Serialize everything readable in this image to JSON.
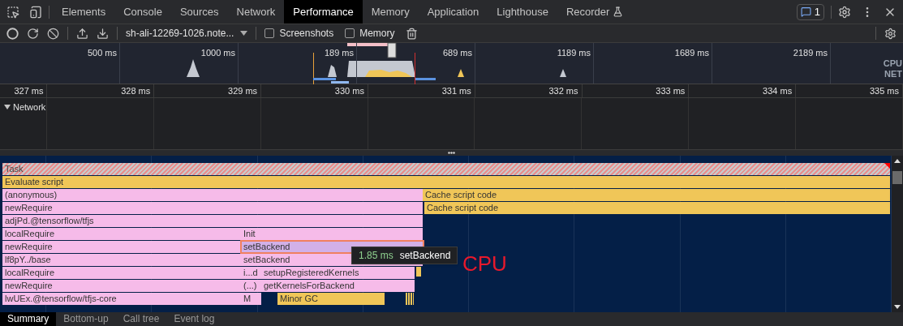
{
  "tabs": [
    {
      "label": "Elements",
      "selected": false,
      "experimental": false
    },
    {
      "label": "Console",
      "selected": false,
      "experimental": false
    },
    {
      "label": "Sources",
      "selected": false,
      "experimental": false
    },
    {
      "label": "Network",
      "selected": false,
      "experimental": false
    },
    {
      "label": "Performance",
      "selected": true,
      "experimental": false
    },
    {
      "label": "Memory",
      "selected": false,
      "experimental": false
    },
    {
      "label": "Application",
      "selected": false,
      "experimental": false
    },
    {
      "label": "Lighthouse",
      "selected": false,
      "experimental": false
    },
    {
      "label": "Recorder",
      "selected": false,
      "experimental": true
    }
  ],
  "issues_badge": {
    "count": "1"
  },
  "toolbar": {
    "recording": "sh-ali-12269-1026.note...",
    "checkboxes": [
      {
        "label": "Screenshots",
        "checked": false
      },
      {
        "label": "Memory",
        "checked": false
      }
    ]
  },
  "overview": {
    "ticks": [
      "500 ms",
      "1000 ms",
      "189 ms",
      "689 ms",
      "1189 ms",
      "1689 ms",
      "2189 ms"
    ],
    "lanes": [
      "CPU",
      "NET"
    ]
  },
  "ruler": [
    "327 ms",
    "328 ms",
    "329 ms",
    "330 ms",
    "331 ms",
    "332 ms",
    "333 ms",
    "334 ms",
    "335 ms"
  ],
  "tracks": [
    {
      "label": "Network",
      "expanded": true
    }
  ],
  "flame_rows": [
    [
      {
        "label": "Task",
        "kind": "task",
        "selected": false
      }
    ],
    [
      {
        "label": "Evaluate script",
        "kind": "script",
        "selected": false
      }
    ],
    [
      {
        "label": "(anonymous)",
        "kind": "function",
        "selected": false
      },
      {
        "label": "Cache script code",
        "kind": "script",
        "selected": false
      }
    ],
    [
      {
        "label": "newRequire",
        "kind": "function",
        "selected": false
      },
      {
        "label": "Cache script code",
        "kind": "script",
        "selected": false
      }
    ],
    [
      {
        "label": "adjPd.@tensorflow/tfjs",
        "kind": "function",
        "selected": false
      }
    ],
    [
      {
        "label": "localRequire",
        "kind": "function",
        "selected": false
      },
      {
        "label": "Init",
        "kind": "function",
        "selected": false
      }
    ],
    [
      {
        "label": "newRequire",
        "kind": "function",
        "selected": false
      },
      {
        "label": "setBackend",
        "kind": "function",
        "selected": true
      }
    ],
    [
      {
        "label": "lf8pY../base",
        "kind": "function",
        "selected": false
      },
      {
        "label": "setBackend",
        "kind": "function",
        "selected": false
      }
    ],
    [
      {
        "label": "localRequire",
        "kind": "function",
        "selected": false
      },
      {
        "label": "i...d",
        "kind": "function",
        "selected": false
      },
      {
        "label": "setupRegisteredKernels",
        "kind": "function",
        "selected": false
      }
    ],
    [
      {
        "label": "newRequire",
        "kind": "function",
        "selected": false
      },
      {
        "label": "(...)",
        "kind": "function",
        "selected": false
      },
      {
        "label": "getKernelsForBackend",
        "kind": "function",
        "selected": false
      }
    ],
    [
      {
        "label": "lwUEx.@tensorflow/tfjs-core",
        "kind": "function",
        "selected": false
      },
      {
        "label": "M",
        "kind": "function",
        "selected": false
      },
      {
        "label": "Minor GC",
        "kind": "script",
        "selected": false
      }
    ]
  ],
  "tooltip": {
    "duration": "1.85 ms",
    "name": "setBackend"
  },
  "annotation": "CPU",
  "bottom_tabs": [
    {
      "label": "Summary",
      "selected": true
    },
    {
      "label": "Bottom-up",
      "selected": false
    },
    {
      "label": "Call tree",
      "selected": false
    },
    {
      "label": "Event log",
      "selected": false
    }
  ]
}
